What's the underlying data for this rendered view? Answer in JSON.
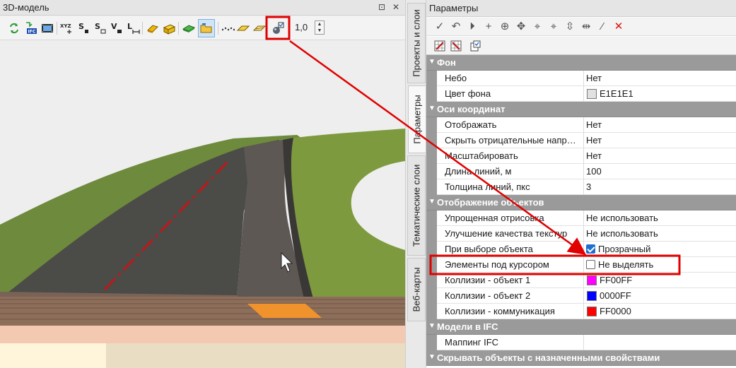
{
  "left_panel": {
    "title": "3D-модель",
    "pin_glyph": "⊡",
    "close_glyph": "✕",
    "zoom_value": "1,0"
  },
  "toolbar3d": {
    "icons": [
      "refresh-icon",
      "ifc-import-icon",
      "film-icon",
      "xyz-icon",
      "s-point-icon",
      "s-area-icon",
      "v-volume-icon",
      "l-length-icon",
      "eraser-icon",
      "box-select-icon",
      "layer-green-icon",
      "folder-highlight-icon",
      "dotted-line-icon",
      "plane-icon",
      "plane-outline-icon",
      "cursor-highlight-icon"
    ],
    "labels": {
      "xyz": "XYZ",
      "s1": "S",
      "s2": "S",
      "v": "V",
      "l": "L",
      "ifc": "IFC"
    }
  },
  "tabs": [
    {
      "label": "Проекты и слои",
      "active": false
    },
    {
      "label": "Параметры",
      "active": true
    },
    {
      "label": "Тематические слои",
      "active": false
    },
    {
      "label": "Веб-карты",
      "active": false
    }
  ],
  "right_panel": {
    "title": "Параметры",
    "toolbar1_icons": [
      "check-icon",
      "undo-icon",
      "step-icon",
      "plus-icon",
      "crosshair-icon",
      "move-icon",
      "select-point-icon",
      "select-text-icon",
      "align-icon",
      "split-icon",
      "pipette-icon",
      "delete-icon"
    ],
    "toolbar2_icons": [
      "grid-check-icon",
      "grid-cross-icon",
      "copy-settings-icon"
    ]
  },
  "groups": [
    {
      "title": "Фон",
      "rows": [
        {
          "name": "Небо",
          "value": "Нет",
          "kind": "text"
        },
        {
          "name": "Цвет фона",
          "value": "E1E1E1",
          "kind": "color",
          "color": "#E1E1E1"
        }
      ]
    },
    {
      "title": "Оси координат",
      "rows": [
        {
          "name": "Отображать",
          "value": "Нет",
          "kind": "text"
        },
        {
          "name": "Скрыть отрицательные напр…",
          "value": "Нет",
          "kind": "text"
        },
        {
          "name": "Масштабировать",
          "value": "Нет",
          "kind": "text"
        },
        {
          "name": "Длина линий, м",
          "value": "100",
          "kind": "text"
        },
        {
          "name": "Толщина линий, пкс",
          "value": "3",
          "kind": "text"
        }
      ]
    },
    {
      "title": "Отображение объектов",
      "rows": [
        {
          "name": "Упрощенная отрисовка",
          "value": "Не использовать",
          "kind": "text"
        },
        {
          "name": "Улучшение качества текстур",
          "value": "Не использовать",
          "kind": "text"
        },
        {
          "name": "При выборе объекта",
          "value": "Прозрачный",
          "kind": "check",
          "checked": true
        },
        {
          "name": "Элементы под курсором",
          "value": "Не выделять",
          "kind": "check",
          "checked": false
        },
        {
          "name": "Коллизии - объект 1",
          "value": "FF00FF",
          "kind": "color",
          "color": "#FF00FF"
        },
        {
          "name": "Коллизии - объект 2",
          "value": "0000FF",
          "kind": "color",
          "color": "#0000FF"
        },
        {
          "name": "Коллизии - коммуникация",
          "value": "FF0000",
          "kind": "color",
          "color": "#FF0000"
        }
      ]
    },
    {
      "title": "Модели в IFC",
      "rows": [
        {
          "name": "Маппинг IFC",
          "value": "",
          "kind": "text"
        }
      ]
    },
    {
      "title": "Скрывать объекты с назначенными свойствами",
      "rows": []
    }
  ],
  "colors": {
    "accent_blue": "#1f6fd1",
    "group_header": "#9a9a9a",
    "annotation_red": "#e00000"
  }
}
